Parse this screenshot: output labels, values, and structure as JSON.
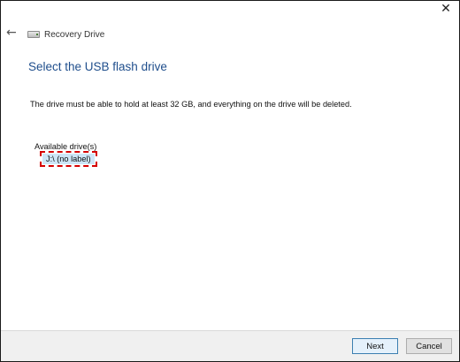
{
  "window": {
    "title": "Recovery Drive",
    "close_glyph": "✕",
    "back_glyph": "←"
  },
  "page": {
    "heading": "Select the USB flash drive",
    "description": "The drive must be able to hold at least 32 GB, and everything on the drive will be deleted.",
    "drives_label": "Available drive(s)",
    "drives": [
      {
        "label": "J:\\ (no label)",
        "selected": true
      }
    ]
  },
  "buttons": {
    "next": "Next",
    "cancel": "Cancel"
  },
  "colors": {
    "heading": "#1f4e8c",
    "selection": "#cde6f7",
    "highlight_border": "#d40000",
    "footer": "#f0f0f0"
  },
  "icons": {
    "back": "back-arrow-icon",
    "drive": "drive-icon",
    "close": "close-icon"
  }
}
